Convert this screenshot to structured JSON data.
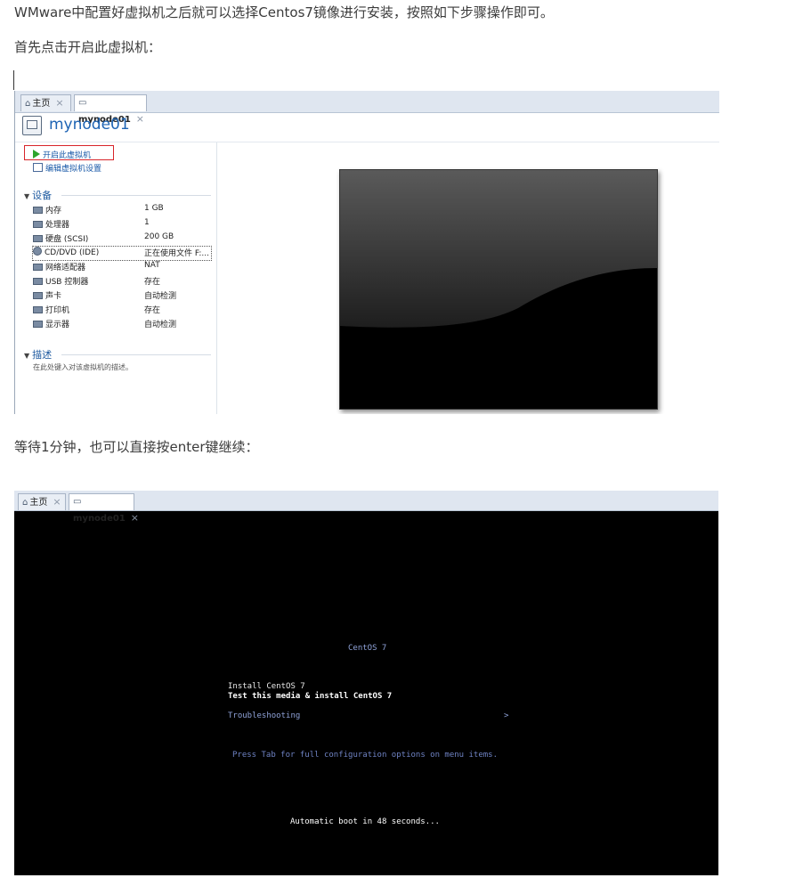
{
  "article": {
    "paragraph_1": "WMware中配置好虚拟机之后就可以选择Centos7镜像进行安装，按照如下步骤操作即可。",
    "paragraph_2": "首先点击开启此虚拟机：",
    "paragraph_3": "等待1分钟，也可以直接按enter键继续："
  },
  "vmware_summary": {
    "tabs": [
      {
        "label": "主页",
        "icon": "home-icon"
      },
      {
        "label": "mynode01",
        "icon": "vm-icon"
      }
    ],
    "vm_name": "mynode01",
    "actions": {
      "power_on": "开启此虚拟机",
      "edit_settings": "编辑虚拟机设置"
    },
    "devices_section": "设备",
    "devices": [
      {
        "name": "内存",
        "value": "1 GB",
        "icon": "memory-icon"
      },
      {
        "name": "处理器",
        "value": "1",
        "icon": "cpu-icon"
      },
      {
        "name": "硬盘 (SCSI)",
        "value": "200 GB",
        "icon": "disk-icon"
      },
      {
        "name": "CD/DVD (IDE)",
        "value": "正在使用文件 F:...",
        "icon": "cdrom-icon"
      },
      {
        "name": "网络适配器",
        "value": "NAT",
        "icon": "network-icon"
      },
      {
        "name": "USB 控制器",
        "value": "存在",
        "icon": "usb-icon"
      },
      {
        "name": "声卡",
        "value": "自动检测",
        "icon": "sound-icon"
      },
      {
        "name": "打印机",
        "value": "存在",
        "icon": "printer-icon"
      },
      {
        "name": "显示器",
        "value": "自动检测",
        "icon": "display-icon"
      }
    ],
    "description_section": "描述",
    "description_placeholder": "在此处键入对该虚拟机的描述。"
  },
  "vmware_console": {
    "tabs": [
      {
        "label": "主页",
        "icon": "home-icon"
      },
      {
        "label": "mynode01",
        "icon": "vm-icon"
      }
    ],
    "boot_title": "CentOS 7",
    "menu": [
      "Install CentOS 7",
      "Test this media & install CentOS 7",
      "Troubleshooting"
    ],
    "submenu_arrow": ">",
    "help_text": "Press Tab for full configuration options on menu items.",
    "autoboot": "Automatic boot in 48 seconds..."
  },
  "colors": {
    "highlight_box": "#d8252b",
    "vm_title": "#1e64b4",
    "link": "#1a5aa8"
  }
}
